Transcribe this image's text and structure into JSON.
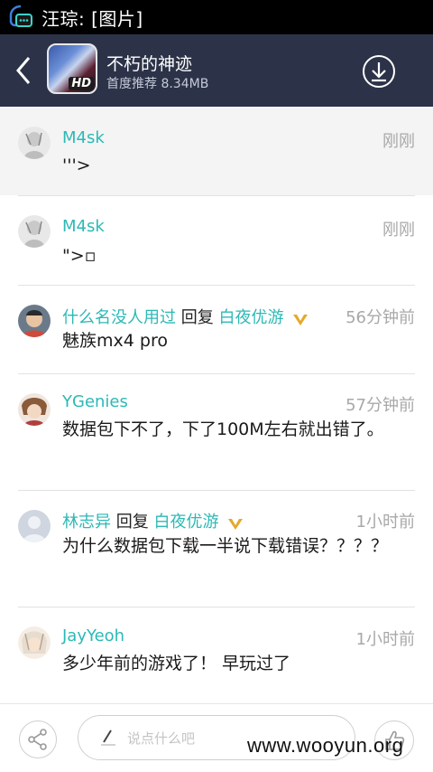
{
  "status_bar": {
    "title": "汪琮: [图片]",
    "icon": "chat-bubble-icon"
  },
  "header": {
    "back_icon": "chevron-left-icon",
    "app_name": "不朽的神迹",
    "app_meta": "首度推荐 8.34MB",
    "app_icon_badge": "HD",
    "download_icon": "download-circle-icon"
  },
  "comments": [
    {
      "user": "M4sk",
      "reply_word": "",
      "reply_to": "",
      "time": "刚刚",
      "content": "'''>"
    },
    {
      "user": "M4sk",
      "reply_word": "",
      "reply_to": "",
      "time": "刚刚",
      "content": "\">▫"
    },
    {
      "user": "什么名没人用过",
      "reply_word": "回复",
      "reply_to": "白夜优游",
      "time": "56分钟前",
      "content": "魅族mx4 pro"
    },
    {
      "user": "YGenies",
      "reply_word": "",
      "reply_to": "",
      "time": "57分钟前",
      "content": "数据包下不了，下了100M左右就出错了。"
    },
    {
      "user": "林志异",
      "reply_word": "回复",
      "reply_to": "白夜优游",
      "time": "1小时前",
      "content": "为什么数据包下载一半说下载错误？？？？"
    },
    {
      "user": "JayYeoh",
      "reply_word": "",
      "reply_to": "",
      "time": "1小时前",
      "content": "多少年前的游戏了！ 早玩过了"
    }
  ],
  "bottom_bar": {
    "share_icon": "share-icon",
    "comment_placeholder": "说点什么吧",
    "pen_icon": "pen-icon",
    "like_icon": "thumbs-up-icon"
  },
  "watermark": "www.wooyun.org",
  "colors": {
    "header_bg": "#2c3348",
    "username": "#2cb9b6",
    "badge": "#e5a82a"
  }
}
